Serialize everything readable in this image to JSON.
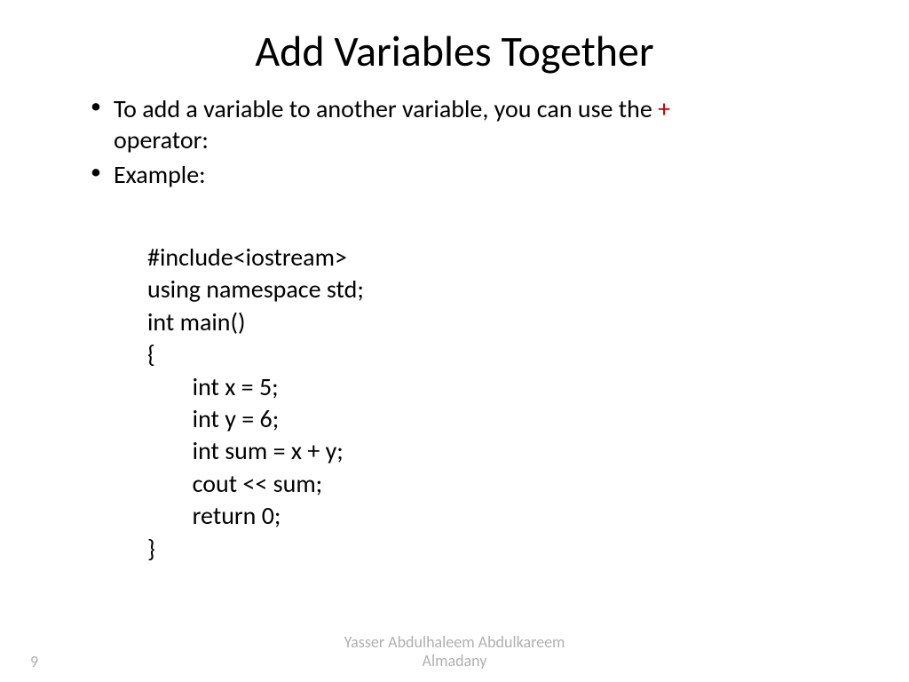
{
  "title": "Add Variables Together",
  "bullets": {
    "line1_text": "To add a variable to another variable, you can use the ",
    "operator": "+",
    "line1_cont": "operator:",
    "line2": "Example:"
  },
  "code": {
    "l1": "#include<iostream>",
    "l2": "using namespace std;",
    "l3": "int main()",
    "l4": "{",
    "l5": "int x = 5;",
    "l6": "int y = 6;",
    "l7": "int sum = x + y;",
    "l8": "cout << sum;",
    "l9": "return 0;",
    "l10": "}"
  },
  "footer": {
    "author_line1": "Yasser Abdulhaleem Abdulkareem",
    "author_line2": "Almadany",
    "page_number": "9"
  }
}
